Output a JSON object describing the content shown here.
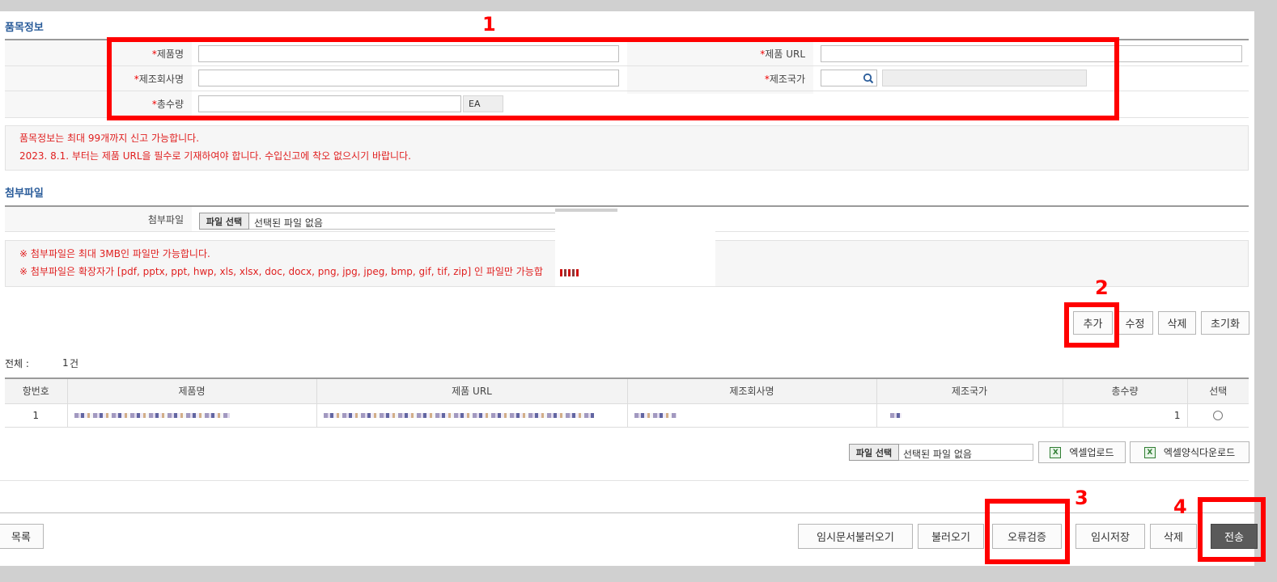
{
  "section_item": {
    "title": "품목정보",
    "fields": {
      "product_name": {
        "required": "*",
        "label": "제품명",
        "value": ""
      },
      "product_url": {
        "required": "*",
        "label": "제품 URL",
        "value": ""
      },
      "manufacturer": {
        "required": "*",
        "label": "제조회사명",
        "value": ""
      },
      "country": {
        "required": "*",
        "label": "제조국가",
        "value": ""
      },
      "quantity": {
        "required": "*",
        "label": "총수량",
        "unit": "EA"
      }
    },
    "notes": [
      "품목정보는 최대 99개까지 신고 가능합니다.",
      "2023. 8.1. 부터는 제품 URL을 필수로 기재하여야 합니다. 수입신고에 착오 없으시기 바랍니다."
    ]
  },
  "section_attach": {
    "title": "첨부파일",
    "label": "첨부파일",
    "file_button": "파일 선택",
    "file_status": "선택된 파일 없음",
    "notes": [
      "※ 첨부파일은 최대 3MB인 파일만 가능합니다.",
      "※ 첨부파일은 확장자가 [pdf, pptx, ppt, hwp, xls, xlsx, doc, docx, png, jpg, jpeg, bmp, gif, tif, zip] 인 파일만 가능합"
    ]
  },
  "item_buttons": {
    "add": "추가",
    "edit": "수정",
    "delete": "삭제",
    "reset": "초기화"
  },
  "total": {
    "label": "전체 :",
    "count": "1",
    "unit": "건"
  },
  "table": {
    "headers": [
      "항번호",
      "제품명",
      "제품 URL",
      "제조회사명",
      "제조국가",
      "총수량",
      "선택"
    ],
    "rows": [
      {
        "no": "1",
        "quantity": "1"
      }
    ]
  },
  "excel": {
    "file_button": "파일 선택",
    "file_status": "선택된 파일 없음",
    "upload": "엑셀업로드",
    "template_download": "엑셀양식다운로드"
  },
  "bottom": {
    "list": "목록",
    "load_temp": "임시문서불러오기",
    "load": "불러오기",
    "validate": "오류검증",
    "save_temp": "임시저장",
    "delete": "삭제",
    "submit": "전송"
  },
  "annotations": [
    "1",
    "2",
    "3",
    "4"
  ],
  "colors": {
    "annotation": "#ff0000",
    "notice_text": "#e02020",
    "section_title": "#2a5c9a"
  }
}
